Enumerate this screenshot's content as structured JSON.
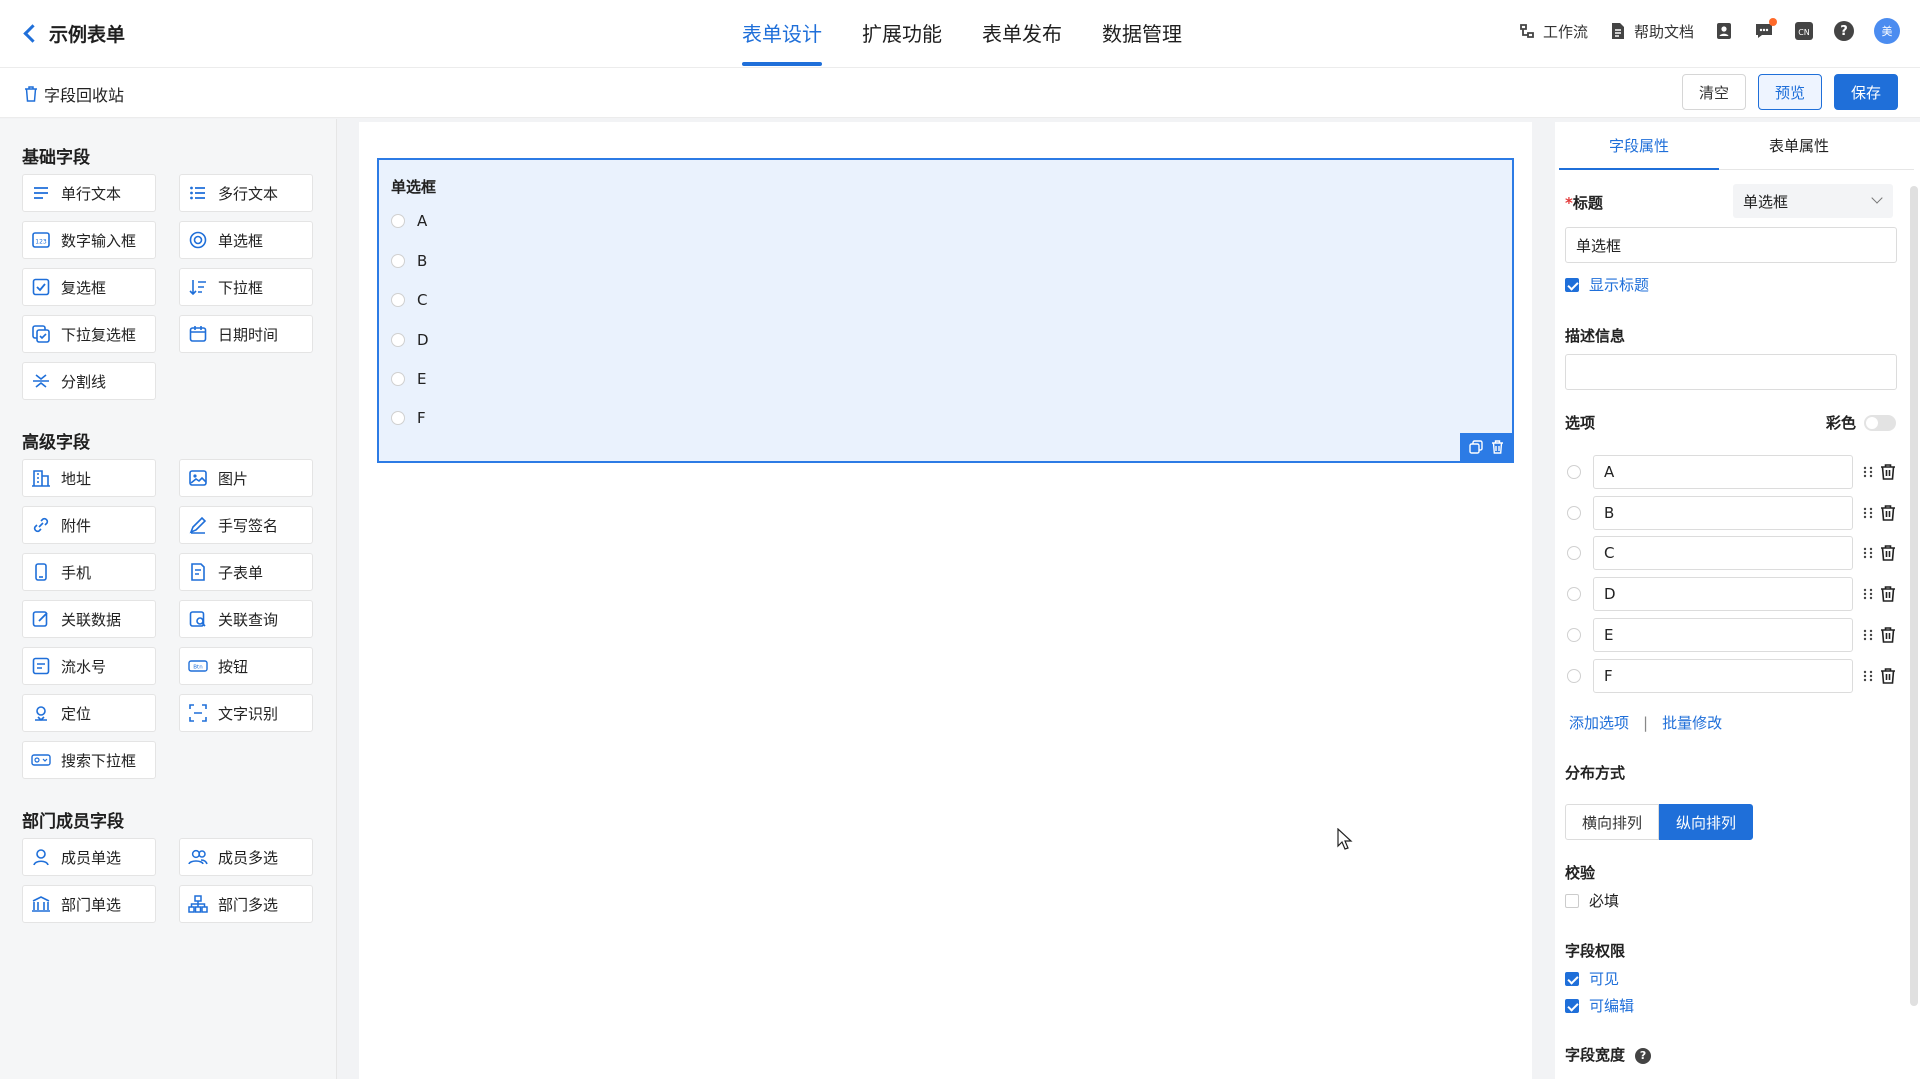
{
  "header": {
    "back_label": "示例表单",
    "tabs": [
      "表单设计",
      "扩展功能",
      "表单发布",
      "数据管理"
    ],
    "tools": {
      "workflow": "工作流",
      "help_doc": "帮助文档",
      "avatar": "美",
      "help": "?"
    }
  },
  "subbar": {
    "recycle": "字段回收站",
    "clear": "清空",
    "preview": "预览",
    "save": "保存"
  },
  "left": {
    "basic_title": "基础字段",
    "basic": [
      "单行文本",
      "多行文本",
      "数字输入框",
      "单选框",
      "复选框",
      "下拉框",
      "下拉复选框",
      "日期时间",
      "分割线"
    ],
    "advanced_title": "高级字段",
    "advanced": [
      "地址",
      "图片",
      "附件",
      "手写签名",
      "手机",
      "子表单",
      "关联数据",
      "关联查询",
      "流水号",
      "按钮",
      "定位",
      "文字识别",
      "搜索下拉框"
    ],
    "dept_title": "部门成员字段",
    "dept": [
      "成员单选",
      "成员多选",
      "部门单选",
      "部门多选"
    ]
  },
  "canvas": {
    "widget_title": "单选框",
    "options": [
      "A",
      "B",
      "C",
      "D",
      "E",
      "F"
    ]
  },
  "right": {
    "tabs": [
      "字段属性",
      "表单属性"
    ],
    "title_label": "标题",
    "title_required": "*",
    "type_select": "单选框",
    "title_value": "单选框",
    "show_title": "显示标题",
    "desc_label": "描述信息",
    "desc_value": "",
    "options_label": "选项",
    "color_label": "彩色",
    "options": [
      "A",
      "B",
      "C",
      "D",
      "E",
      "F"
    ],
    "add_option": "添加选项",
    "sep": "|",
    "batch_edit": "批量修改",
    "layout_label": "分布方式",
    "layout_h": "横向排列",
    "layout_v": "纵向排列",
    "validate_label": "校验",
    "required": "必填",
    "perm_label": "字段权限",
    "visible": "可见",
    "editable": "可编辑",
    "width_label": "字段宽度"
  },
  "colors": {
    "accent": "#1f6fd9",
    "widget_bg": "#eaf2fd",
    "widget_border": "#2c7be5"
  }
}
